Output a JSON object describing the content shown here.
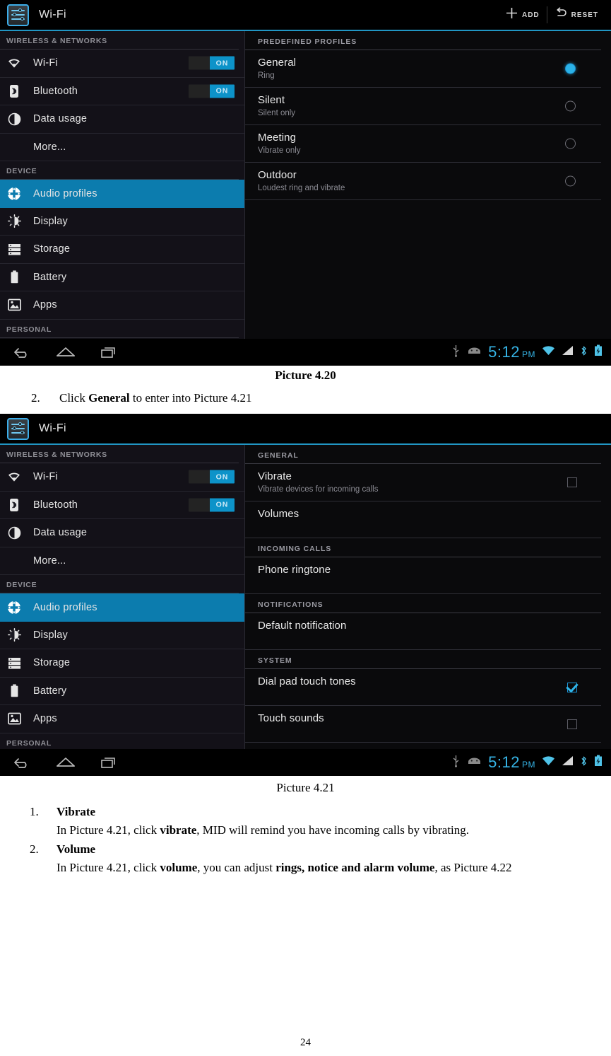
{
  "shot1": {
    "actionbar": {
      "app_icon": "settings-sliders-icon",
      "title": "Wi-Fi",
      "add_label": "ADD",
      "reset_label": "RESET",
      "add_icon": "plus-icon",
      "reset_icon": "undo-arrow-icon"
    },
    "sidebar": {
      "sections": [
        {
          "header": "WIRELESS & NETWORKS",
          "items": [
            {
              "label": "Wi-Fi",
              "icon": "wifi-icon",
              "toggle": "ON",
              "selected": false,
              "indent": false
            },
            {
              "label": "Bluetooth",
              "icon": "bluetooth-icon",
              "toggle": "ON",
              "selected": false,
              "indent": false
            },
            {
              "label": "Data usage",
              "icon": "data-usage-icon",
              "toggle": null,
              "selected": false,
              "indent": false
            },
            {
              "label": "More...",
              "icon": null,
              "toggle": null,
              "selected": false,
              "indent": true
            }
          ]
        },
        {
          "header": "DEVICE",
          "items": [
            {
              "label": "Audio profiles",
              "icon": "audio-profiles-icon",
              "toggle": null,
              "selected": true,
              "indent": false
            },
            {
              "label": "Display",
              "icon": "display-icon",
              "toggle": null,
              "selected": false,
              "indent": false
            },
            {
              "label": "Storage",
              "icon": "storage-icon",
              "toggle": null,
              "selected": false,
              "indent": false
            },
            {
              "label": "Battery",
              "icon": "battery-icon",
              "toggle": null,
              "selected": false,
              "indent": false
            },
            {
              "label": "Apps",
              "icon": "apps-icon",
              "toggle": null,
              "selected": false,
              "indent": false
            }
          ]
        },
        {
          "header": "PERSONAL",
          "items": []
        }
      ]
    },
    "content": {
      "section_header": "PREDEFINED PROFILES",
      "profiles": [
        {
          "title": "General",
          "subtitle": "Ring",
          "selected": true
        },
        {
          "title": "Silent",
          "subtitle": "Silent only",
          "selected": false
        },
        {
          "title": "Meeting",
          "subtitle": "Vibrate only",
          "selected": false
        },
        {
          "title": "Outdoor",
          "subtitle": "Loudest ring and vibrate",
          "selected": false
        }
      ]
    },
    "navbar": {
      "buttons": [
        "back-icon",
        "home-icon",
        "recents-icon"
      ],
      "status_icons": [
        "usb-icon",
        "android-robot-icon",
        "wifi-signal-icon",
        "cellular-signal-icon",
        "bluetooth-icon",
        "battery-charging-icon"
      ],
      "time": "5:12",
      "ampm": "PM"
    }
  },
  "shot2": {
    "actionbar": {
      "app_icon": "settings-sliders-icon",
      "title": "Wi-Fi"
    },
    "sidebar": {
      "sections": [
        {
          "header": "WIRELESS & NETWORKS",
          "items": [
            {
              "label": "Wi-Fi",
              "icon": "wifi-icon",
              "toggle": "ON",
              "selected": false,
              "indent": false
            },
            {
              "label": "Bluetooth",
              "icon": "bluetooth-icon",
              "toggle": "ON",
              "selected": false,
              "indent": false
            },
            {
              "label": "Data usage",
              "icon": "data-usage-icon",
              "toggle": null,
              "selected": false,
              "indent": false
            },
            {
              "label": "More...",
              "icon": null,
              "toggle": null,
              "selected": false,
              "indent": true
            }
          ]
        },
        {
          "header": "DEVICE",
          "items": [
            {
              "label": "Audio profiles",
              "icon": "audio-profiles-icon",
              "toggle": null,
              "selected": true,
              "indent": false
            },
            {
              "label": "Display",
              "icon": "display-icon",
              "toggle": null,
              "selected": false,
              "indent": false
            },
            {
              "label": "Storage",
              "icon": "storage-icon",
              "toggle": null,
              "selected": false,
              "indent": false
            },
            {
              "label": "Battery",
              "icon": "battery-icon",
              "toggle": null,
              "selected": false,
              "indent": false
            },
            {
              "label": "Apps",
              "icon": "apps-icon",
              "toggle": null,
              "selected": false,
              "indent": false
            }
          ]
        },
        {
          "header": "PERSONAL",
          "items": []
        }
      ]
    },
    "content": {
      "groups": [
        {
          "header": "GENERAL",
          "rows": [
            {
              "title": "Vibrate",
              "subtitle": "Vibrate devices for incoming calls",
              "checkbox": "unchecked"
            },
            {
              "title": "Volumes",
              "subtitle": null,
              "checkbox": null
            }
          ]
        },
        {
          "header": "INCOMING CALLS",
          "rows": [
            {
              "title": "Phone ringtone",
              "subtitle": null,
              "checkbox": null
            }
          ]
        },
        {
          "header": "NOTIFICATIONS",
          "rows": [
            {
              "title": "Default notification",
              "subtitle": null,
              "checkbox": null
            }
          ]
        },
        {
          "header": "SYSTEM",
          "rows": [
            {
              "title": "Dial pad touch tones",
              "subtitle": null,
              "checkbox": "checked"
            },
            {
              "title": "Touch sounds",
              "subtitle": null,
              "checkbox": "unchecked"
            }
          ]
        }
      ]
    },
    "navbar": {
      "time": "5:12",
      "ampm": "PM"
    }
  },
  "document": {
    "caption_1": "Picture 4.20",
    "step_2_num": "2.",
    "step_2_pre": "Click ",
    "step_2_bold": "General",
    "step_2_post": " to enter into Picture 4.21",
    "caption_2": "Picture 4.21",
    "items": [
      {
        "num": "1.",
        "heading": "Vibrate",
        "body_pre": "In Picture 4.21, click ",
        "body_bold": "vibrate",
        "body_post": ", MID will remind you have incoming calls by vibrating."
      },
      {
        "num": "2.",
        "heading": "Volume",
        "body_pre": "In Picture 4.21, click ",
        "body_bold": "volume",
        "body_mid": ", you can adjust ",
        "body_bold2": "rings, notice and alarm volume",
        "body_post": ", as Picture 4.22"
      }
    ],
    "page_number": "24"
  },
  "colors": {
    "accent": "#0d93c9",
    "selected_row": "#0c7cae",
    "clock": "#36b4e6",
    "actionbar_underline": "#2196c4"
  }
}
